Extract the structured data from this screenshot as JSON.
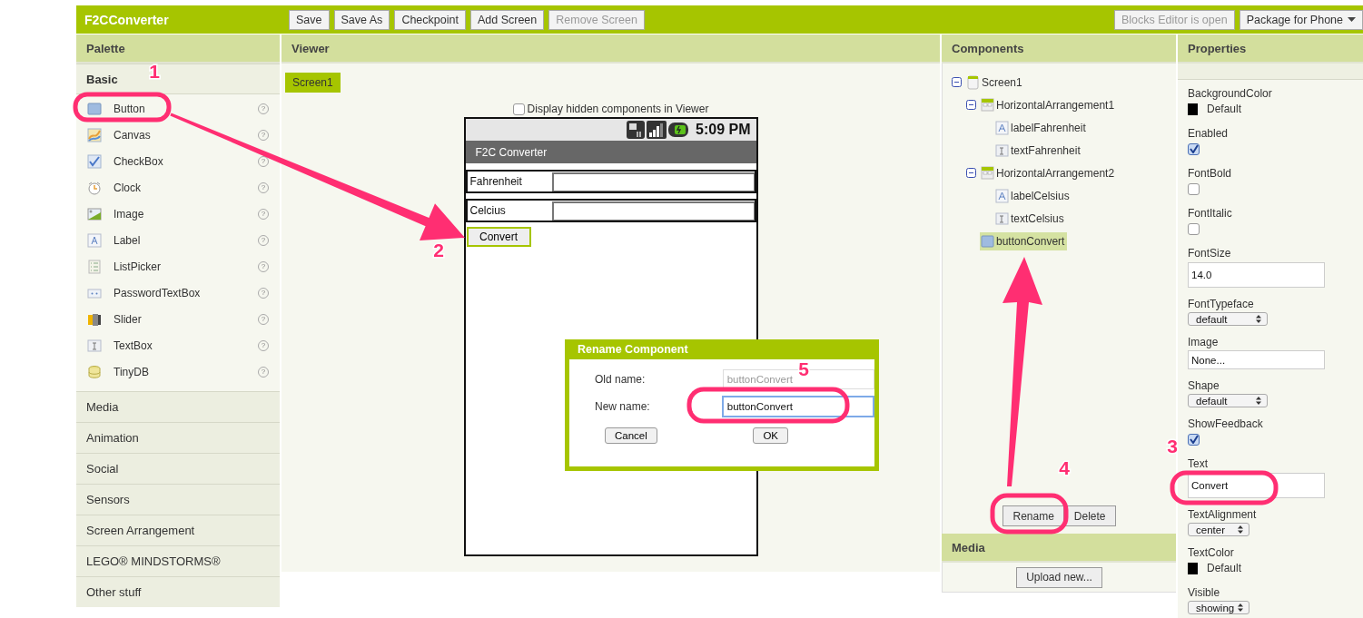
{
  "app": {
    "title": "F2CConverter"
  },
  "toolbar": [
    {
      "label": "Save",
      "disabled": false
    },
    {
      "label": "Save As",
      "disabled": false
    },
    {
      "label": "Checkpoint",
      "disabled": false
    },
    {
      "label": "Add Screen",
      "disabled": false
    },
    {
      "label": "Remove Screen",
      "disabled": true
    }
  ],
  "toolbar_right": [
    {
      "label": "Blocks Editor is open",
      "disabled": true,
      "kind": "plain"
    },
    {
      "label": "Package for Phone",
      "disabled": false,
      "kind": "dropdown"
    }
  ],
  "palette": {
    "title": "Palette",
    "sections": [
      {
        "label": "Basic",
        "expanded": true,
        "items": [
          {
            "label": "Button",
            "kind": "button",
            "help": "?"
          },
          {
            "label": "Canvas",
            "kind": "canvas",
            "help": "?"
          },
          {
            "label": "CheckBox",
            "kind": "checkbox",
            "help": "?"
          },
          {
            "label": "Clock",
            "kind": "clock",
            "help": "?"
          },
          {
            "label": "Image",
            "kind": "image",
            "help": "?"
          },
          {
            "label": "Label",
            "kind": "label",
            "help": "?"
          },
          {
            "label": "ListPicker",
            "kind": "listpicker",
            "help": "?"
          },
          {
            "label": "PasswordTextBox",
            "kind": "password",
            "help": "?"
          },
          {
            "label": "Slider",
            "kind": "slider",
            "help": "?"
          },
          {
            "label": "TextBox",
            "kind": "textbox",
            "help": "?"
          },
          {
            "label": "TinyDB",
            "kind": "tinydb",
            "help": "?"
          }
        ]
      },
      {
        "label": "Media",
        "expanded": false
      },
      {
        "label": "Animation",
        "expanded": false
      },
      {
        "label": "Social",
        "expanded": false
      },
      {
        "label": "Sensors",
        "expanded": false
      },
      {
        "label": "Screen Arrangement",
        "expanded": false
      },
      {
        "label": "LEGO® MINDSTORMS®",
        "expanded": false
      },
      {
        "label": "Other stuff",
        "expanded": false
      }
    ]
  },
  "viewer": {
    "title": "Viewer",
    "screen_tab": {
      "label": "Screen1",
      "selected": true
    },
    "hidden_checkbox": {
      "label": "Display hidden components in Viewer",
      "checked": false
    },
    "phone": {
      "time": "5:09 PM",
      "app_title": "F2C Converter",
      "rows": [
        {
          "label": "Fahrenheit"
        },
        {
          "label": "Celcius"
        }
      ],
      "button": {
        "label": "Convert",
        "selected": true
      }
    }
  },
  "rename_dialog": {
    "title": "Rename Component",
    "old_label": "Old name:",
    "old_value": "buttonConvert",
    "new_label": "New name:",
    "new_value": "buttonConvert",
    "buttons": [
      "Cancel",
      "OK"
    ]
  },
  "components": {
    "title": "Components",
    "tree": [
      {
        "label": "Screen1",
        "kind": "screen",
        "selected": false,
        "expanded": true,
        "children": [
          {
            "label": "HorizontalArrangement1",
            "kind": "arrangement",
            "selected": false,
            "expanded": true,
            "children": [
              {
                "label": "labelFahrenheit",
                "kind": "label",
                "selected": false
              },
              {
                "label": "textFahrenheit",
                "kind": "textbox",
                "selected": false
              }
            ]
          },
          {
            "label": "HorizontalArrangement2",
            "kind": "arrangement",
            "selected": false,
            "expanded": true,
            "children": [
              {
                "label": "labelCelsius",
                "kind": "label",
                "selected": false
              },
              {
                "label": "textCelsius",
                "kind": "textbox",
                "selected": false
              }
            ]
          },
          {
            "label": "buttonConvert",
            "kind": "button",
            "selected": true
          }
        ]
      }
    ],
    "buttons": [
      "Rename",
      "Delete"
    ],
    "media": {
      "title": "Media",
      "button": "Upload new..."
    }
  },
  "properties": {
    "title": "Properties",
    "items": [
      {
        "label": "BackgroundColor",
        "kind": "color",
        "value": "Default",
        "color": "#000000"
      },
      {
        "label": "Enabled",
        "kind": "checkbox",
        "checked": true
      },
      {
        "label": "FontBold",
        "kind": "checkbox",
        "checked": false
      },
      {
        "label": "FontItalic",
        "kind": "checkbox",
        "checked": false
      },
      {
        "label": "FontSize",
        "kind": "text",
        "value": "14.0"
      },
      {
        "label": "FontTypeface",
        "kind": "select",
        "value": "default"
      },
      {
        "label": "Image",
        "kind": "asset",
        "value": "None..."
      },
      {
        "label": "Shape",
        "kind": "select",
        "value": "default"
      },
      {
        "label": "ShowFeedback",
        "kind": "checkbox",
        "checked": true
      },
      {
        "label": "Text",
        "kind": "text",
        "value": "Convert"
      },
      {
        "label": "TextAlignment",
        "kind": "select",
        "value": "center"
      },
      {
        "label": "TextColor",
        "kind": "color",
        "value": "Default",
        "color": "#000000"
      },
      {
        "label": "Visible",
        "kind": "select",
        "value": "showing"
      }
    ]
  },
  "annotations": [
    {
      "label": "1"
    },
    {
      "label": "2"
    },
    {
      "label": "3"
    },
    {
      "label": "4"
    },
    {
      "label": "5"
    }
  ]
}
